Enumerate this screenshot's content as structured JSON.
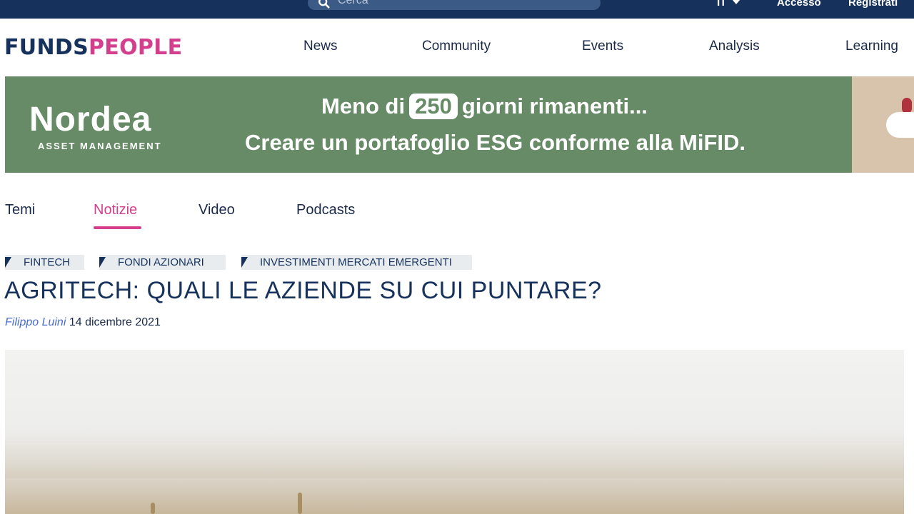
{
  "topbar": {
    "search_placeholder": "Cerca",
    "language": "IT",
    "login": "Accesso",
    "register": "Registrati"
  },
  "header": {
    "logo_part1": "FUNDS",
    "logo_part2": "PEOPLE",
    "nav": [
      "News",
      "Community",
      "Events",
      "Analysis",
      "Learning"
    ]
  },
  "banner": {
    "brand": "Nordea",
    "brand_sub": "ASSET MANAGEMENT",
    "line1_prefix": "Meno di",
    "line1_number": "250",
    "line1_suffix": "giorni rimanenti...",
    "line2": "Creare un portafoglio ESG conforme alla MiFID."
  },
  "subnav": {
    "items": [
      "Temi",
      "Notizie",
      "Video",
      "Podcasts"
    ],
    "active": "Notizie"
  },
  "article": {
    "tags": [
      "FINTECH",
      "FONDI AZIONARI",
      "INVESTIMENTI MERCATI EMERGENTI"
    ],
    "title": "AGRITECH: QUALI LE AZIENDE SU CUI PUNTARE?",
    "author": "Filippo Luini",
    "date": "14 dicembre 2021"
  },
  "colors": {
    "navy": "#16325c",
    "accent_pink": "#d43f8d",
    "banner_green": "#678b66"
  }
}
